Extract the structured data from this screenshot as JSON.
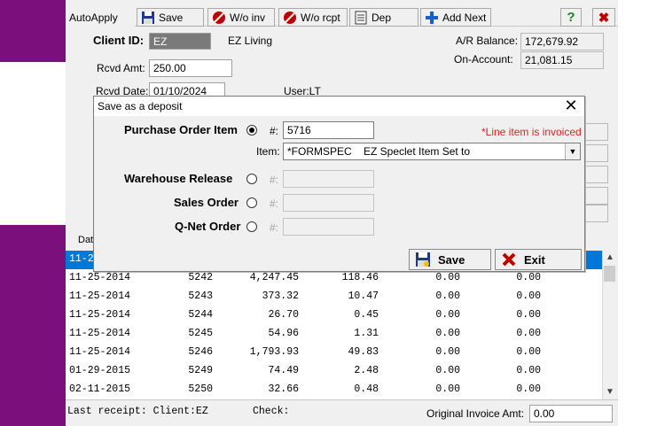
{
  "toolbar": {
    "autoapply": "AutoApply",
    "save": "Save",
    "wo_inv": "W/o inv",
    "wo_rcpt": "W/o rcpt",
    "dep": "Dep",
    "add_next": "Add Next",
    "help": "?",
    "close": "✖"
  },
  "client": {
    "id_label": "Client ID:",
    "id_value": "EZ",
    "name": "EZ Living",
    "ar_label": "A/R Balance:",
    "ar_value": "172,679.92",
    "onacct_label": "On-Account:",
    "onacct_value": "21,081.15",
    "rcvd_amt_label": "Rcvd Amt:",
    "rcvd_amt_value": "250.00",
    "rcvd_date_label": "Rcvd Date:",
    "rcvd_date_value": "01/10/2024",
    "user_label": "User:LT"
  },
  "grid": {
    "header_stub": "Dat",
    "rows": [
      {
        "date": "11-2",
        "num": "",
        "amt": "",
        "c4": "",
        "c5": "",
        "c6": ""
      },
      {
        "date": "11-25-2014",
        "num": "5242",
        "amt": "4,247.45",
        "c4": "118.46",
        "c5": "0.00",
        "c6": "0.00"
      },
      {
        "date": "11-25-2014",
        "num": "5243",
        "amt": "373.32",
        "c4": "10.47",
        "c5": "0.00",
        "c6": "0.00"
      },
      {
        "date": "11-25-2014",
        "num": "5244",
        "amt": "26.70",
        "c4": "0.45",
        "c5": "0.00",
        "c6": "0.00"
      },
      {
        "date": "11-25-2014",
        "num": "5245",
        "amt": "54.96",
        "c4": "1.31",
        "c5": "0.00",
        "c6": "0.00"
      },
      {
        "date": "11-25-2014",
        "num": "5246",
        "amt": "1,793.93",
        "c4": "49.83",
        "c5": "0.00",
        "c6": "0.00"
      },
      {
        "date": "01-29-2015",
        "num": "5249",
        "amt": "74.49",
        "c4": "2.48",
        "c5": "0.00",
        "c6": "0.00"
      },
      {
        "date": "02-11-2015",
        "num": "5250",
        "amt": "32.66",
        "c4": "0.48",
        "c5": "0.00",
        "c6": "0.00"
      }
    ]
  },
  "status": {
    "last_receipt": "Last receipt:  Client:EZ",
    "check": "Check:",
    "orig_label": "Original Invoice Amt:",
    "orig_value": "0.00"
  },
  "dialog": {
    "title": "Save as a deposit",
    "close": "✕",
    "po_label": "Purchase Order Item",
    "hash": "#:",
    "po_value": "5716",
    "warning": "*Line item is invoiced",
    "item_label": "Item:",
    "item_code": "*FORMSPEC",
    "item_desc": "EZ Speclet Item Set to",
    "wr_label": "Warehouse Release",
    "so_label": "Sales Order",
    "qnet_label": "Q-Net Order",
    "save_btn": "Save",
    "exit_btn": "Exit"
  },
  "colors": {
    "desktop": "#7b0f7b",
    "selection": "#0078d7",
    "warning": "#e02020"
  }
}
